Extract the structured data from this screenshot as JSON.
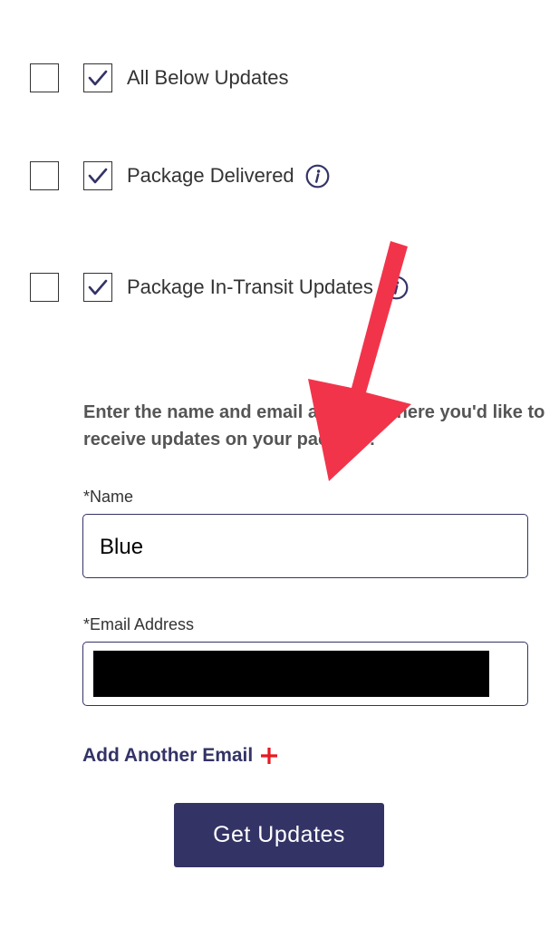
{
  "notification_options": [
    {
      "label": "All Below Updates",
      "first_checked": false,
      "second_checked": true,
      "has_info": false
    },
    {
      "label": "Package Delivered",
      "first_checked": false,
      "second_checked": true,
      "has_info": true
    },
    {
      "label": "Package In-Transit Updates",
      "first_checked": false,
      "second_checked": true,
      "has_info": true
    }
  ],
  "prompt_text": "Enter the name and email address where you'd like to receive updates on your package:",
  "name_field": {
    "label": "*Name",
    "value": "Blue"
  },
  "email_field": {
    "label": "*Email Address",
    "value": "",
    "redacted": true
  },
  "add_email_label": "Add Another Email",
  "submit_label": "Get Updates",
  "icons": {
    "info": "info-icon",
    "check": "checkmark-icon",
    "add": "plus-icon",
    "annotation": "red-arrow-annotation"
  },
  "colors": {
    "brand": "#333366",
    "accent": "#e71921",
    "arrow": "#f2344b",
    "text": "#333333"
  }
}
